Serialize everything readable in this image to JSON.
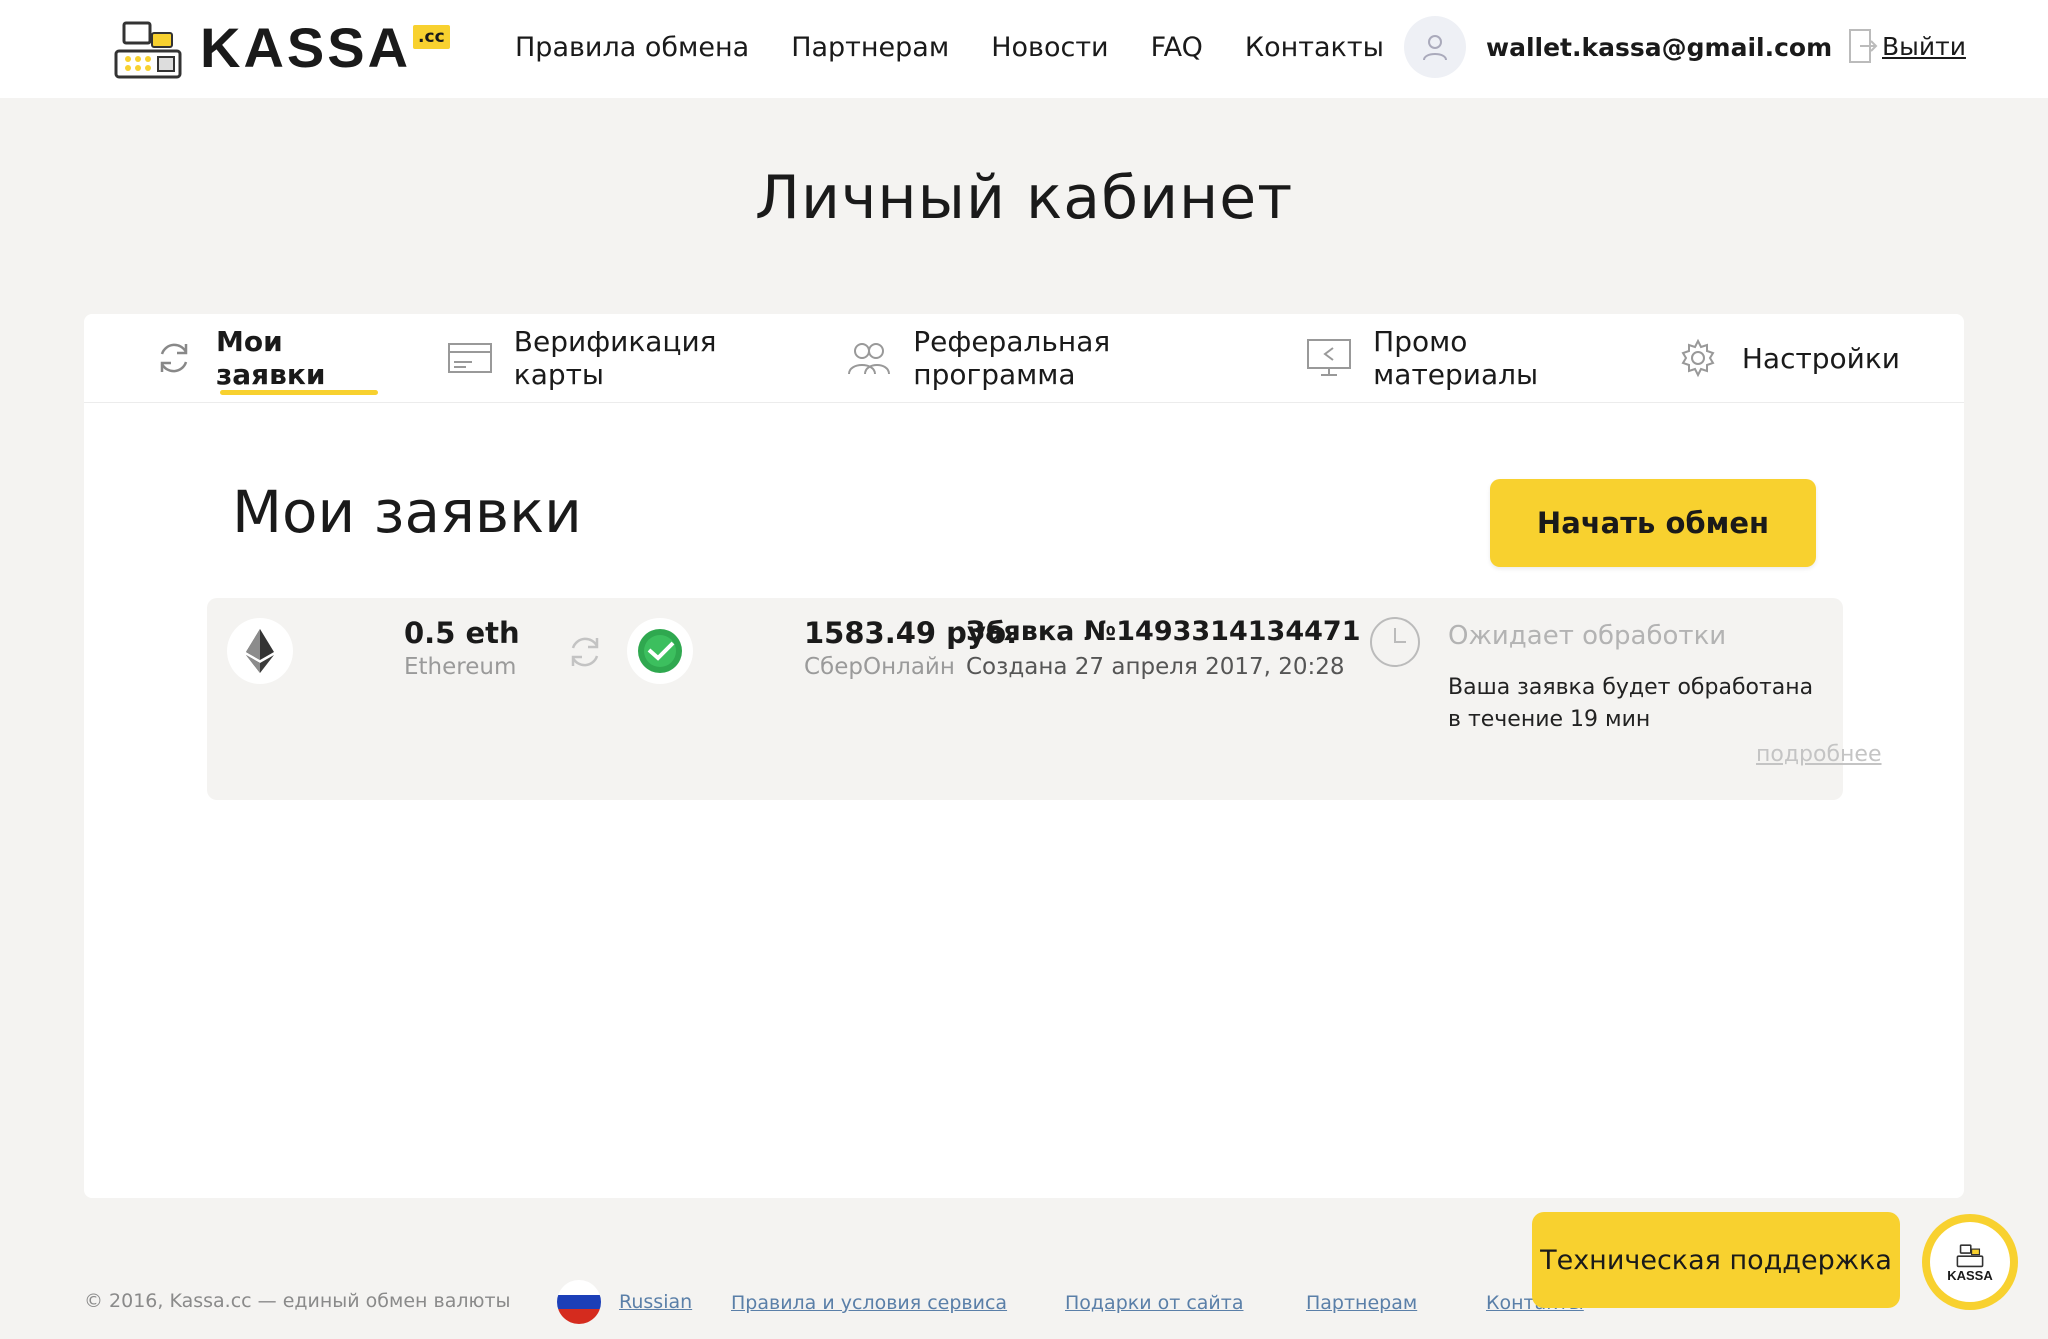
{
  "brand": {
    "name": "KASSA",
    "tld": ".cc"
  },
  "nav": {
    "items": [
      {
        "label": "Правила обмена"
      },
      {
        "label": "Партнерам"
      },
      {
        "label": "Новости"
      },
      {
        "label": "FAQ"
      },
      {
        "label": "Контакты"
      }
    ]
  },
  "user": {
    "email": "wallet.kassa@gmail.com",
    "logout_label": "Выйти"
  },
  "page": {
    "title": "Личный кабинет"
  },
  "tabs": [
    {
      "label": "Мои заявки",
      "icon": "refresh-icon",
      "active": true
    },
    {
      "label": "Верификация карты",
      "icon": "card-icon",
      "active": false
    },
    {
      "label": "Реферальная программа",
      "icon": "users-icon",
      "active": false
    },
    {
      "label": "Промо материалы",
      "icon": "monitor-share-icon",
      "active": false
    },
    {
      "label": "Настройки",
      "icon": "gear-icon",
      "active": false
    }
  ],
  "orders_section": {
    "title": "Мои заявки",
    "start_button": "Начать обмен"
  },
  "order": {
    "from_amount": "0.5 eth",
    "from_method": "Ethereum",
    "to_amount": "1583.49 руб.",
    "to_method": "СберОнлайн",
    "number": "Заявка №1493314134471",
    "created": "Создана 27 апреля 2017, 20:28",
    "status": "Ожидает обработки",
    "status_desc": "Ваша заявка будет обработана в течение 19 мин",
    "more": "подробнее"
  },
  "footer": {
    "copyright": "© 2016, Kassa.cc — единый обмен валюты",
    "language": "Russian",
    "links": [
      {
        "label": "Правила и условия сервиса"
      },
      {
        "label": "Подарки от сайта"
      },
      {
        "label": "Партнерам"
      },
      {
        "label": "Контакты"
      }
    ]
  },
  "support": {
    "label": "Техническая поддержка",
    "avatar_text": "KASSA"
  },
  "colors": {
    "accent": "#f8d12f",
    "background": "#f4f3f1",
    "panel": "#ffffff"
  }
}
